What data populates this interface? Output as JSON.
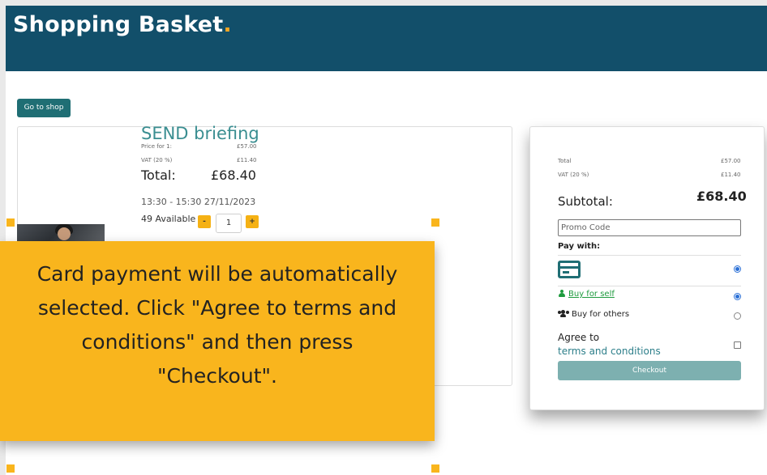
{
  "header": {
    "brand": "Shopping Basket",
    "brand_dot": "."
  },
  "toolbar": {
    "go_to_shop": "Go to shop"
  },
  "product": {
    "title": "SEND briefing",
    "price_for_label": "Price for 1:",
    "price_for_value": "£57.00",
    "vat_label": "VAT (20 %)",
    "vat_value": "£11.40",
    "total_label": "Total:",
    "total_value": "£68.40",
    "datetime": "13:30 - 15:30 27/11/2023",
    "available": "49 Available",
    "decrement": "-",
    "quantity": "1",
    "increment": "+"
  },
  "summary": {
    "total_label": "Total",
    "total_value": "£57.00",
    "vat_label": "VAT (20 %)",
    "vat_value": "£11.40",
    "subtotal_label": "Subtotal:",
    "subtotal_value": "£68.40",
    "promo_placeholder": "Promo Code",
    "pay_with": "Pay with:",
    "buy_for_self": "Buy for self",
    "buy_for_others": "Buy for others",
    "agree_prefix": "Agree to",
    "agree_link": "terms and conditions",
    "checkout": "Checkout"
  },
  "tooltip": {
    "text": "Card payment will be automatically selected. Click \"Agree to terms and conditions\" and then press \"Checkout\"."
  },
  "colors": {
    "header_bg": "#124f6a",
    "accent_teal": "#3a8e91",
    "tooltip_bg": "#f9b51d",
    "link_green": "#1e9b3e",
    "checkout_bg": "#7db0b0"
  },
  "icons": [
    "credit-card-icon",
    "person-icon",
    "people-icon"
  ]
}
